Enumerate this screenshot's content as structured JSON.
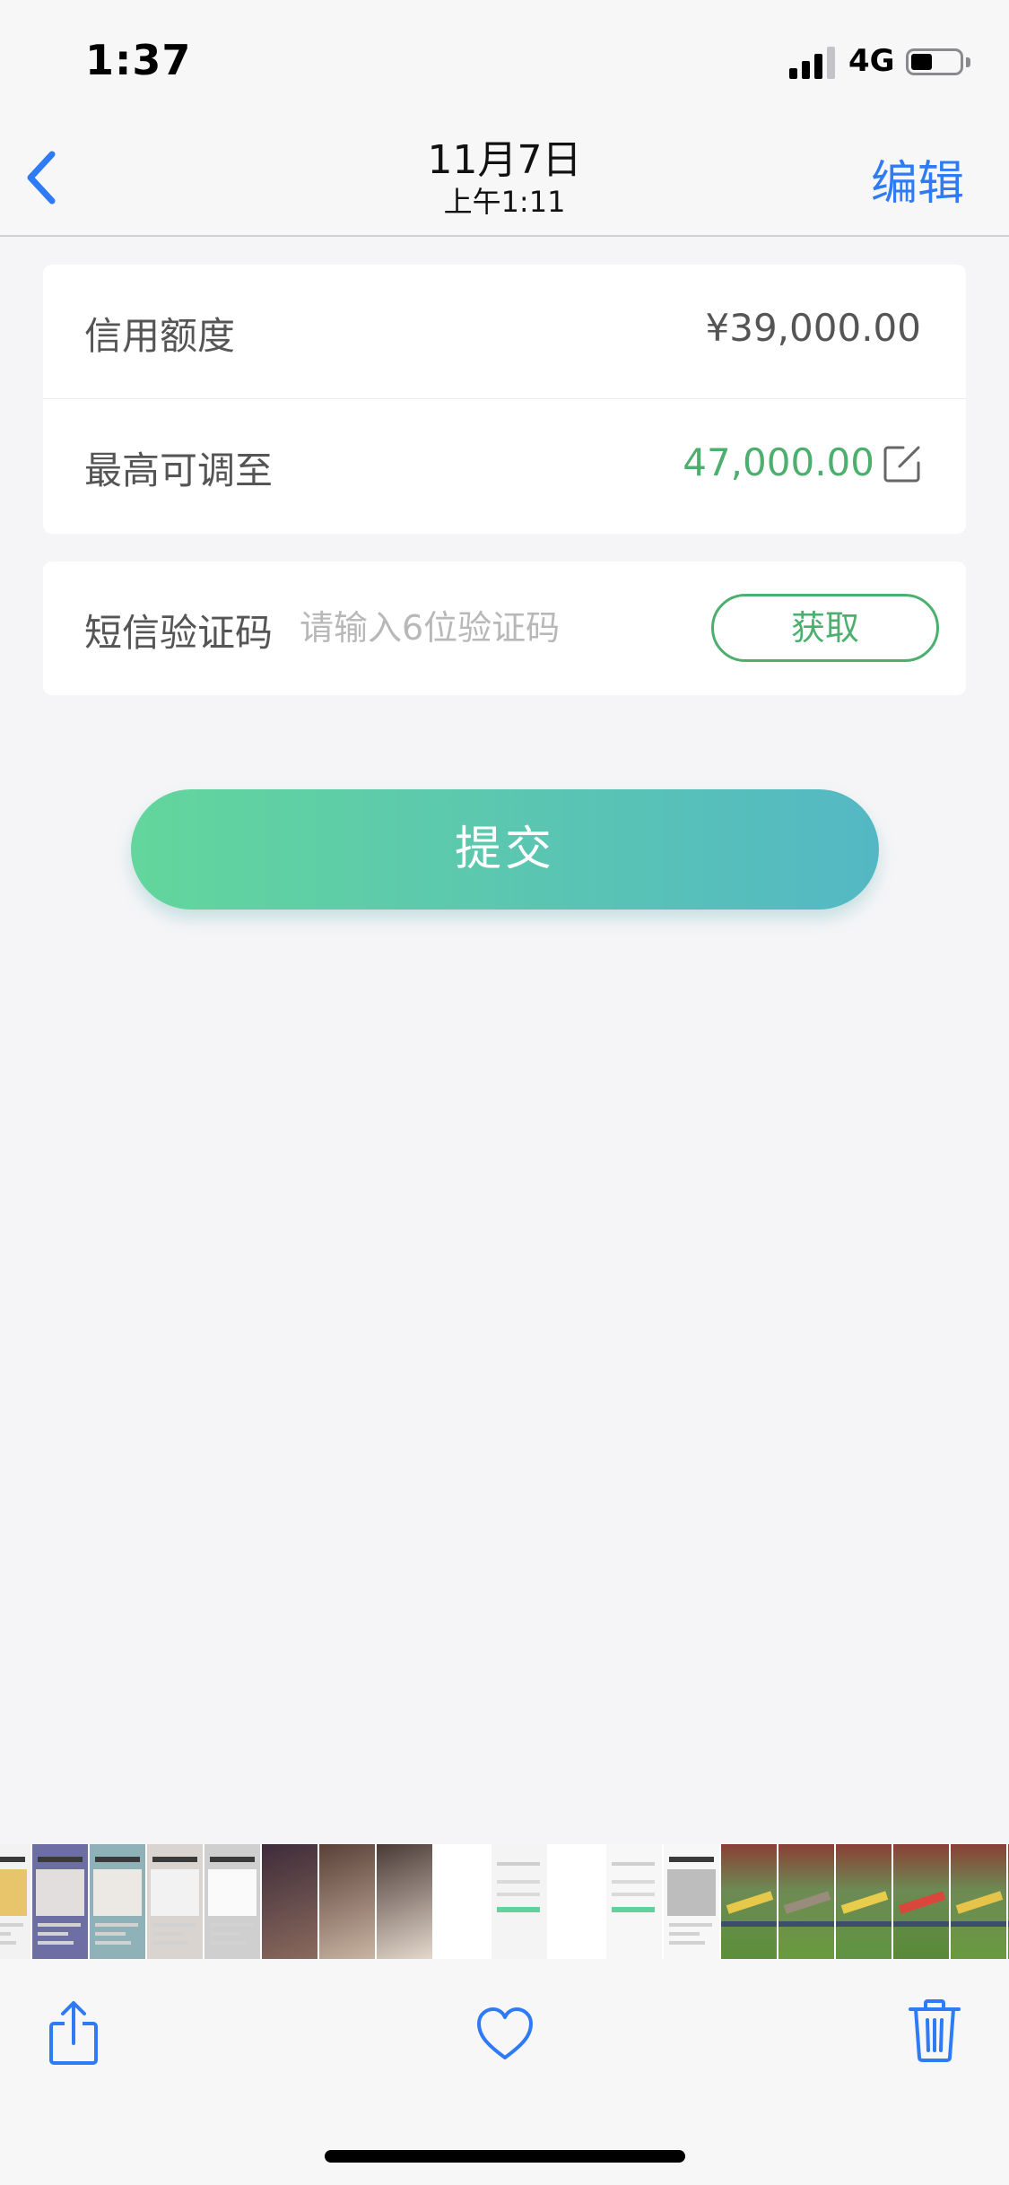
{
  "status_bar": {
    "time": "1:37",
    "network": "4G",
    "signal_bars_active": 3,
    "signal_bars_total": 4,
    "battery_level": 0.45
  },
  "nav": {
    "back_icon": "chevron-left-icon",
    "title": "11月7日",
    "subtitle": "上午1:11",
    "edit_label": "编辑"
  },
  "credit_card": {
    "limit_label": "信用额度",
    "limit_value": "¥39,000.00",
    "max_label": "最高可调至",
    "max_value": "47,000.00",
    "max_edit_icon": "edit-square-icon"
  },
  "sms": {
    "label": "短信验证码",
    "placeholder": "请输入6位验证码",
    "value": "",
    "get_code_label": "获取"
  },
  "submit_label": "提交",
  "thumbnails": [
    {
      "kind": "doc",
      "colors": [
        "#f2f2f2",
        "#e8c46a"
      ]
    },
    {
      "kind": "shop",
      "colors": [
        "#6d6fa4",
        "#e3dede"
      ]
    },
    {
      "kind": "shop",
      "colors": [
        "#8fb2b8",
        "#ece9e4"
      ]
    },
    {
      "kind": "shop",
      "colors": [
        "#d9d4cf",
        "#f2f2f2"
      ]
    },
    {
      "kind": "shop",
      "colors": [
        "#cfcfcf",
        "#fafafa"
      ]
    },
    {
      "kind": "photo",
      "colors": [
        "#3e2c3a",
        "#8a6a5d"
      ]
    },
    {
      "kind": "photo",
      "colors": [
        "#5a4038",
        "#c9b4a2"
      ]
    },
    {
      "kind": "photo",
      "colors": [
        "#4a3a36",
        "#e4d8cc"
      ]
    },
    {
      "kind": "blank",
      "colors": [
        "#ffffff",
        "#ffffff"
      ]
    },
    {
      "kind": "form",
      "colors": [
        "#f4f4f4",
        "#63d19c"
      ]
    },
    {
      "kind": "blank",
      "colors": [
        "#ffffff",
        "#ffffff"
      ]
    },
    {
      "kind": "form",
      "colors": [
        "#f7f7f7",
        "#63d19c"
      ]
    },
    {
      "kind": "doc",
      "colors": [
        "#f7f7f7",
        "#bdbdbd"
      ]
    },
    {
      "kind": "park",
      "colors": [
        "#5c8f3a",
        "#e6c94a"
      ]
    },
    {
      "kind": "park",
      "colors": [
        "#6a9a3e",
        "#9a8c7c"
      ]
    },
    {
      "kind": "park",
      "colors": [
        "#5f9440",
        "#e8cc4c"
      ]
    },
    {
      "kind": "park",
      "colors": [
        "#578a38",
        "#d9463c"
      ]
    },
    {
      "kind": "park",
      "colors": [
        "#6a9a40",
        "#e6c44a"
      ]
    },
    {
      "kind": "park",
      "colors": [
        "#5a8e3c",
        "#9fc24a"
      ]
    }
  ],
  "toolbar": {
    "share_icon": "share-icon",
    "favorite_icon": "heart-icon",
    "delete_icon": "trash-icon"
  },
  "colors": {
    "accent_blue": "#2f7bf6",
    "accent_green": "#4caf6e",
    "submit_gradient_start": "#62d69c",
    "submit_gradient_end": "#54b8c4"
  }
}
